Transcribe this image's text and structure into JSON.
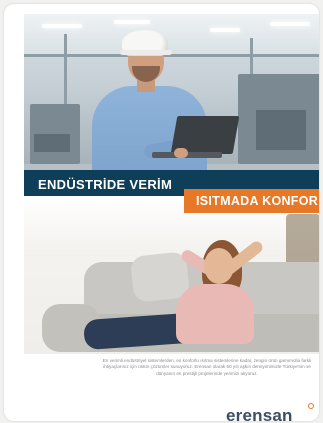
{
  "brochure": {
    "heading_industry": "ENDÜSTRİDE VERİM",
    "heading_comfort": "ISITMADA KONFOR",
    "body_text": "En verimli endüstriyel sistemlerden, en konforlu ısıtma sistemlerine kadar, zengin ürün gamımızla farklı ihtiyaçlarınız için üstün çözümler sunuyoruz. Erensan olarak 50 yılı aşkın deneyimimizle Türkiye'nin ve dünyanın en prestijli projelerinde yerimizi alıyoruz.",
    "brand": "erensan"
  },
  "colors": {
    "navy_band": "#0f3f58",
    "orange_band": "#e77827",
    "logo_text": "#3b4e63"
  }
}
